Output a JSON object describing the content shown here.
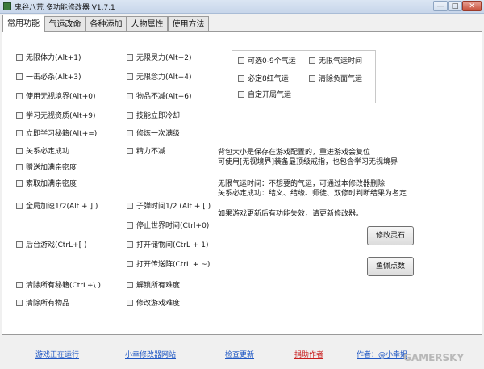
{
  "window": {
    "title": "鬼谷八荒 多功能修改器  V1.7.1",
    "min_glyph": "—",
    "max_glyph": "□",
    "close_glyph": "✕",
    "icon": "app-icon"
  },
  "tabs": [
    {
      "label": "常用功能",
      "active": true
    },
    {
      "label": "气运改命",
      "active": false
    },
    {
      "label": "各种添加",
      "active": false
    },
    {
      "label": "人物属性",
      "active": false
    },
    {
      "label": "使用方法",
      "active": false
    }
  ],
  "options_col1": [
    {
      "label": "无限体力(Alt+1)",
      "checked": false
    },
    {
      "label": "一击必杀(Alt+3)",
      "checked": false
    },
    {
      "label": "使用无视境界(Alt+0)",
      "checked": false
    },
    {
      "label": "学习无视资质(Alt+9)",
      "checked": false
    },
    {
      "label": "立即学习秘籍(Alt+=)",
      "checked": false
    },
    {
      "label": "关系必定成功",
      "checked": false
    },
    {
      "label": "赠送加满亲密度",
      "checked": false
    },
    {
      "label": "索取加满亲密度",
      "checked": false
    },
    {
      "label": "全局加速1/2(Alt + ] )",
      "checked": false
    },
    {
      "label": "后台游戏(CtrL+[ )",
      "checked": false
    },
    {
      "label": "清除所有秘籍(CtrL+\\ )",
      "checked": false
    },
    {
      "label": "清除所有物品",
      "checked": false
    }
  ],
  "options_col2": [
    {
      "label": "无限灵力(Alt+2)",
      "checked": false
    },
    {
      "label": "无限念力(Alt+4)",
      "checked": false
    },
    {
      "label": "物品不减(Alt+6)",
      "checked": false
    },
    {
      "label": "技能立即冷却",
      "checked": false
    },
    {
      "label": "修炼一次满级",
      "checked": false
    },
    {
      "label": "精力不减",
      "checked": false
    },
    {
      "label": "子弹时间1/2 (Alt + [ )",
      "checked": false
    },
    {
      "label": "停止世界时间(Ctrl+0)",
      "checked": false
    },
    {
      "label": "打开储物间(CtrL + 1)",
      "checked": false
    },
    {
      "label": "打开传送阵(CtrL + ~)",
      "checked": false
    },
    {
      "label": "解锁所有难度",
      "checked": false
    },
    {
      "label": "修改游戏难度",
      "checked": false
    }
  ],
  "luck_group": [
    {
      "label": "可选0-9个气运",
      "checked": false
    },
    {
      "label": "无限气运时间",
      "checked": false
    },
    {
      "label": "必定8红气运",
      "checked": false
    },
    {
      "label": "清除负面气运",
      "checked": false
    },
    {
      "label": "自定开局气运",
      "checked": false
    }
  ],
  "notes": [
    "背包大小是保存在游戏配置的，重进游戏会复位",
    "可使用[无视境界]装备最顶级戒指，也包含学习无视境界",
    "无限气运时间：不想要的气运，可通过本修改器删除",
    "关系必定成功：结义、结缘、师徒、双修时判断结果为名定",
    "如果游戏更新后有功能失效，请更新修改器。"
  ],
  "buttons": {
    "modify_spirit_stone": "修改灵石",
    "fish_points": "鱼佩点数"
  },
  "status": {
    "game_running": "游戏正在运行",
    "site": "小幸修改器网站",
    "check_update": "检查更新",
    "donate": "捐助作者",
    "author": "作者：@小幸姐"
  },
  "watermark": "GAMERSKY",
  "colors": {
    "link_blue": "#1f57c4",
    "donate_red": "#c81e1e"
  }
}
